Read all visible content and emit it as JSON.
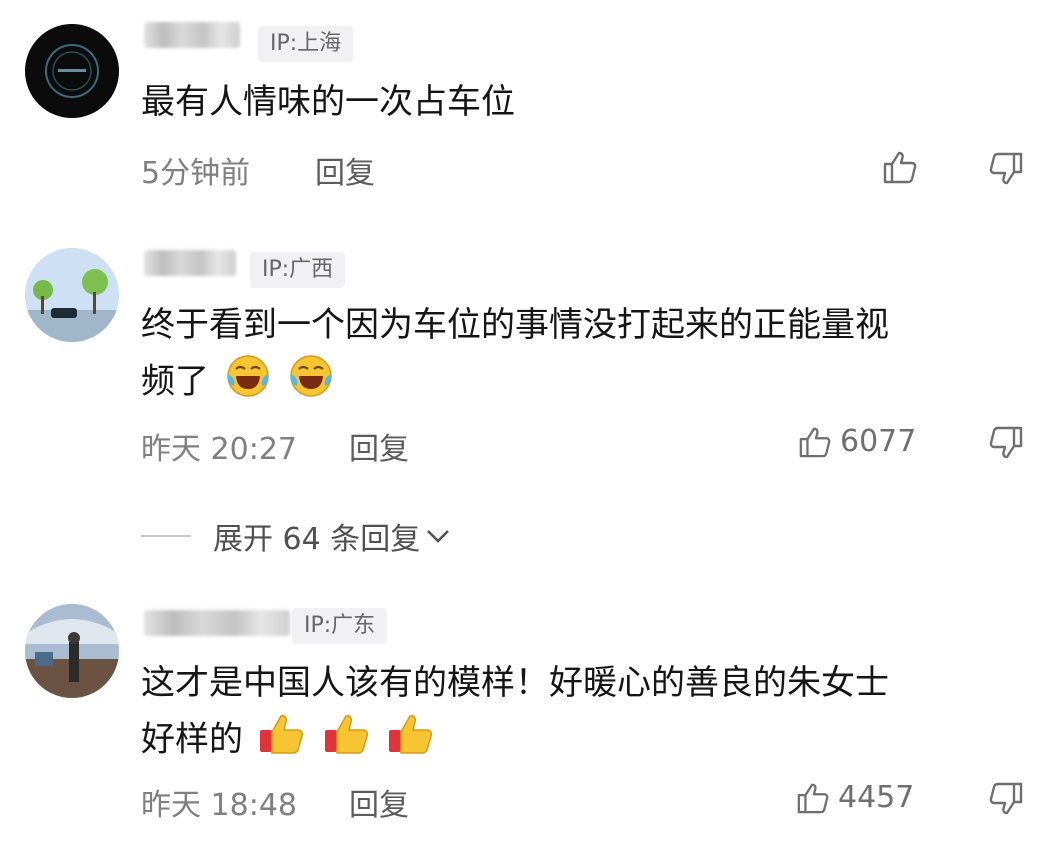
{
  "comments": [
    {
      "ip": "IP:上海",
      "text": "最有人情味的一次占车位",
      "time": "5分钟前",
      "reply": "回复",
      "likes": ""
    },
    {
      "ip": "IP:广西",
      "text_line1": "终于看到一个因为车位的事情没打起来的正能量视",
      "text_line2": "频了",
      "time": "昨天 20:27",
      "reply": "回复",
      "likes": "6077"
    },
    {
      "ip": "IP:广东",
      "text_line1": "这才是中国人该有的模样！好暖心的善良的朱女士",
      "text_line2": "好样的",
      "time": "昨天 18:48",
      "reply": "回复",
      "likes": "4457"
    }
  ],
  "expand_replies": "展开 64 条回复",
  "icons": {
    "like": "thumbs-up-icon",
    "dislike": "thumbs-down-icon",
    "chevron": "chevron-down-icon",
    "laugh_emoji": "laughing-tears-emoji",
    "thumbs_emoji": "thumbs-up-emoji"
  },
  "colors": {
    "meta_text": "#808080",
    "badge_bg": "#f1f1f3",
    "emoji_yellow": "#f7c531"
  }
}
